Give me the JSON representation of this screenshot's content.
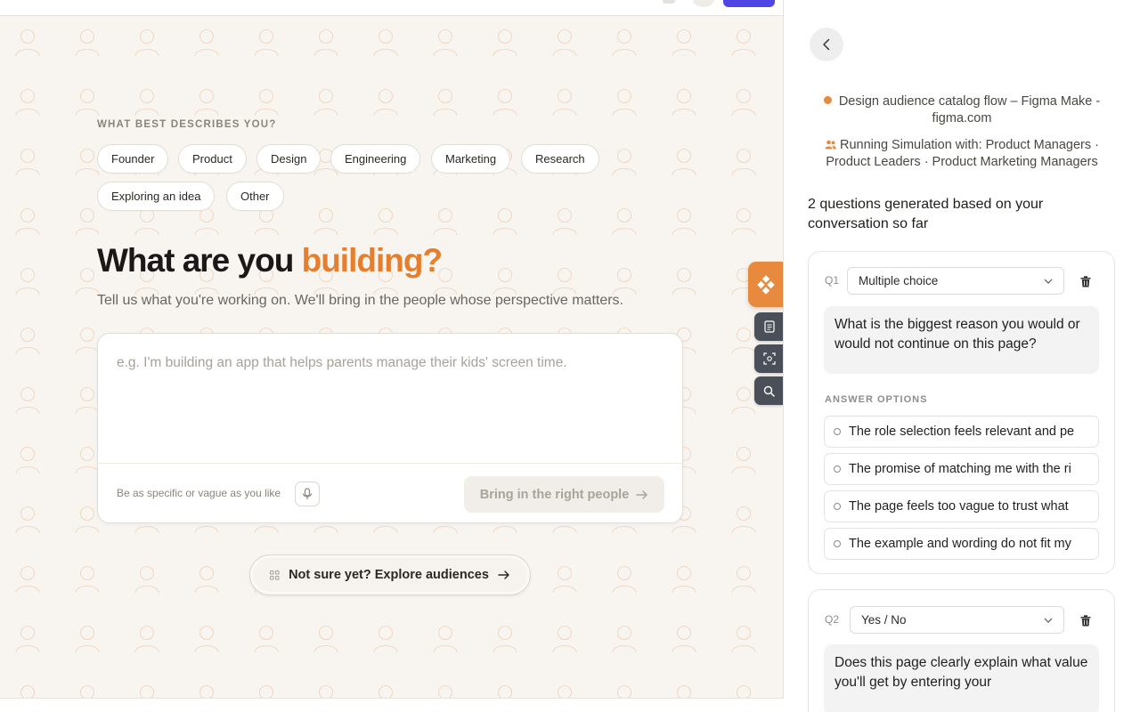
{
  "app": {
    "eyebrow": "WHAT BEST DESCRIBES YOU?",
    "roles": [
      "Founder",
      "Product",
      "Design",
      "Engineering",
      "Marketing",
      "Research",
      "Exploring an idea",
      "Other"
    ],
    "headline_prefix": "What are you",
    "headline_accent": "building?",
    "subheadline": "Tell us what you're working on. We'll bring in the people whose perspective matters.",
    "composer": {
      "placeholder": "e.g. I'm building an app that helps parents manage their kids' screen time.",
      "hint": "Be as specific or vague as you like",
      "submit_label": "Bring in the right people"
    },
    "explore_label": "Not sure yet? Explore audiences",
    "colors": {
      "accent": "#e57e2d",
      "primary_top_button": "#4f46e5",
      "rail_accent": "#e88a3e",
      "rail_dark": "#4b4f59"
    }
  },
  "tool_rail": {
    "items": [
      "figma-logo-icon",
      "document-icon",
      "screenshot-icon",
      "search-icon"
    ]
  },
  "panel": {
    "context_title": "Design audience catalog flow – Figma Make - figma.com",
    "simulation": "Running Simulation with: Product Managers · Product Leaders · Product Marketing Managers",
    "summary": "2 questions generated based on your conversation so far",
    "answer_options_heading": "ANSWER OPTIONS",
    "questions": [
      {
        "label": "Q1",
        "type": "Multiple choice",
        "text": "What is the biggest reason you would or would not continue on this page?",
        "options": [
          "The role selection feels relevant and pe",
          "The promise of matching me with the ri",
          "The page feels too vague to trust what",
          "The example and wording do not fit my"
        ]
      },
      {
        "label": "Q2",
        "type": "Yes / No",
        "text": "Does this page clearly explain what value you'll get by entering your"
      }
    ]
  }
}
